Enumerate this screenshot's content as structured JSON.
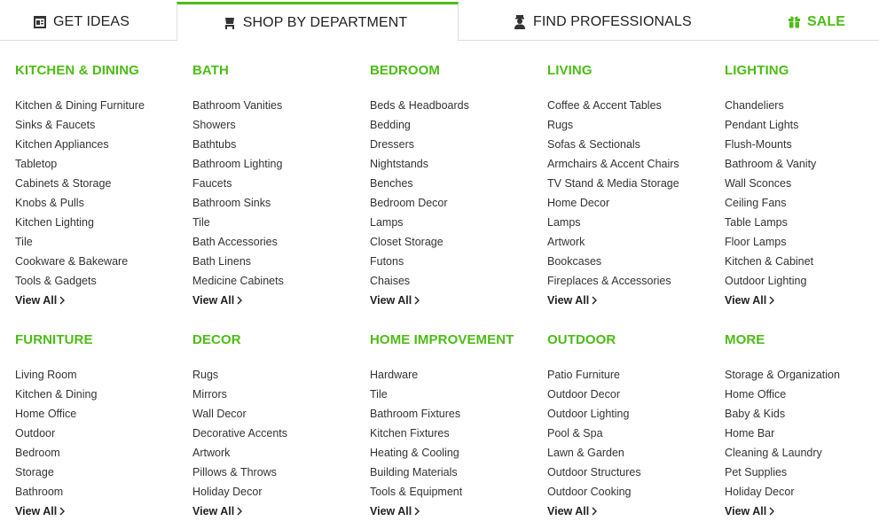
{
  "tabs": {
    "get_ideas": "GET IDEAS",
    "shop_by_department": "SHOP BY DEPARTMENT",
    "find_professionals": "FIND PROFESSIONALS",
    "sale": "SALE"
  },
  "colors": {
    "accent": "#4dbc15",
    "text": "#333333",
    "divider": "#dddddd"
  },
  "icons": {
    "get_ideas": "ideabook-icon",
    "shop": "shopping-cart-icon",
    "pros": "professional-icon",
    "sale": "gift-icon",
    "view_all": "chevron-right-icon"
  },
  "view_all_label": "View All",
  "departments": [
    {
      "title": "KITCHEN & DINING",
      "items": [
        "Kitchen & Dining Furniture",
        "Sinks & Faucets",
        "Kitchen Appliances",
        "Tabletop",
        "Cabinets & Storage",
        "Knobs & Pulls",
        "Kitchen Lighting",
        "Tile",
        "Cookware & Bakeware",
        "Tools & Gadgets"
      ]
    },
    {
      "title": "BATH",
      "items": [
        "Bathroom Vanities",
        "Showers",
        "Bathtubs",
        "Bathroom Lighting",
        "Faucets",
        "Bathroom Sinks",
        "Tile",
        "Bath Accessories",
        "Bath Linens",
        "Medicine Cabinets"
      ]
    },
    {
      "title": "BEDROOM",
      "items": [
        "Beds & Headboards",
        "Bedding",
        "Dressers",
        "Nightstands",
        "Benches",
        "Bedroom Decor",
        "Lamps",
        "Closet Storage",
        "Futons",
        "Chaises"
      ]
    },
    {
      "title": "LIVING",
      "items": [
        "Coffee & Accent Tables",
        "Rugs",
        "Sofas & Sectionals",
        "Armchairs & Accent Chairs",
        "TV Stand & Media Storage",
        "Home Decor",
        "Lamps",
        "Artwork",
        "Bookcases",
        "Fireplaces & Accessories"
      ]
    },
    {
      "title": "LIGHTING",
      "items": [
        "Chandeliers",
        "Pendant Lights",
        "Flush-Mounts",
        "Bathroom & Vanity",
        "Wall Sconces",
        "Ceiling Fans",
        "Table Lamps",
        "Floor Lamps",
        "Kitchen & Cabinet",
        "Outdoor Lighting"
      ]
    },
    {
      "title": "FURNITURE",
      "items": [
        "Living Room",
        "Kitchen & Dining",
        "Home Office",
        "Outdoor",
        "Bedroom",
        "Storage",
        "Bathroom"
      ]
    },
    {
      "title": "DECOR",
      "items": [
        "Rugs",
        "Mirrors",
        "Wall Decor",
        "Decorative Accents",
        "Artwork",
        "Pillows & Throws",
        "Holiday Decor"
      ]
    },
    {
      "title": "HOME IMPROVEMENT",
      "items": [
        "Hardware",
        "Tile",
        "Bathroom Fixtures",
        "Kitchen Fixtures",
        "Heating & Cooling",
        "Building Materials",
        "Tools & Equipment"
      ]
    },
    {
      "title": "OUTDOOR",
      "items": [
        "Patio Furniture",
        "Outdoor Decor",
        "Outdoor Lighting",
        "Pool & Spa",
        "Lawn & Garden",
        "Outdoor Structures",
        "Outdoor Cooking"
      ]
    },
    {
      "title": "MORE",
      "items": [
        "Storage & Organization",
        "Home Office",
        "Baby & Kids",
        "Home Bar",
        "Cleaning & Laundry",
        "Pet Supplies",
        "Holiday Decor"
      ]
    }
  ]
}
